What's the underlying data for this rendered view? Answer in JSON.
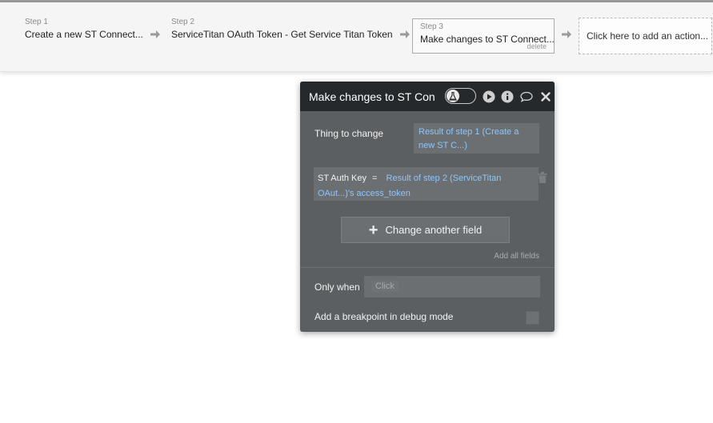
{
  "steps": [
    {
      "num": "Step 1",
      "title": "Create a new ST Connect..."
    },
    {
      "num": "Step 2",
      "title": "ServiceTitan OAuth Token - Get Service Titan Token"
    },
    {
      "num": "Step 3",
      "title": "Make changes to ST Connect...",
      "delete_label": "delete"
    }
  ],
  "add_action_label": "Click here to add an action...",
  "panel": {
    "title": "Make changes to ST Con",
    "thing_to_change_label": "Thing to change",
    "thing_to_change_value": "Result of step 1 (Create a new ST C...)",
    "field": {
      "name": "ST Auth Key",
      "operator": "=",
      "value": "Result of step 2 (ServiceTitan OAut...)'s access_token"
    },
    "change_another_field_label": "Change another field",
    "add_all_fields_label": "Add all fields",
    "only_when_label": "Only when",
    "only_when_placeholder": "Click",
    "breakpoint_label": "Add a breakpoint in debug mode",
    "breakpoint_checked": false
  },
  "colors": {
    "panel_bg": "#5c5f61",
    "panel_header_bg": "#26292b",
    "dynamic_text": "#8bc6ff"
  },
  "icons": [
    "arrow-right-icon",
    "flask-icon",
    "play-icon",
    "info-icon",
    "comment-icon",
    "close-icon",
    "trash-icon",
    "plus-icon"
  ]
}
